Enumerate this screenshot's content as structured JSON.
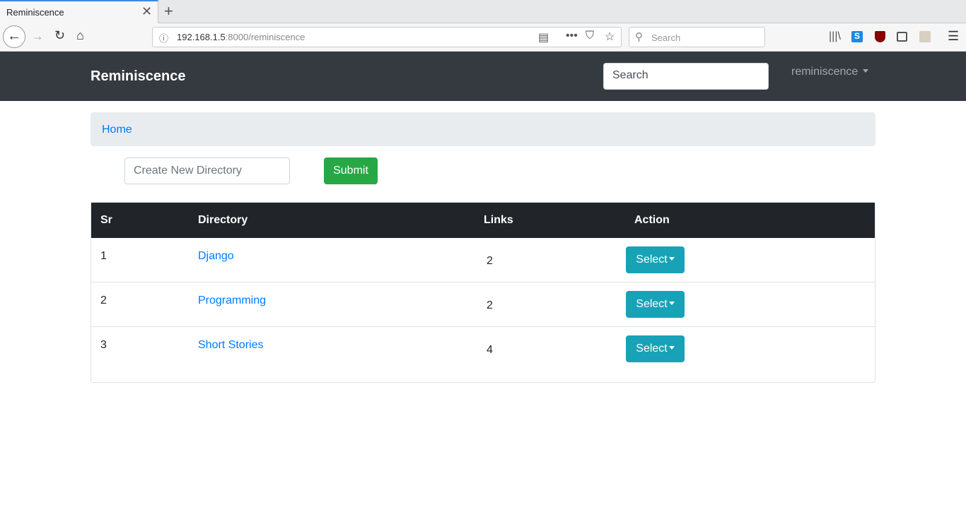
{
  "browser": {
    "tab_title": "Reminiscence",
    "url_host": "192.168.1.5",
    "url_rest": ":8000/reminiscence",
    "search_placeholder": "Search"
  },
  "app": {
    "brand": "Reminiscence",
    "search_placeholder": "Search",
    "user_menu": "reminiscence"
  },
  "breadcrumb": {
    "home": "Home"
  },
  "form": {
    "placeholder": "Create New Directory",
    "submit": "Submit"
  },
  "table": {
    "headers": {
      "sr": "Sr",
      "directory": "Directory",
      "links": "Links",
      "action": "Action"
    },
    "rows": [
      {
        "sr": "1",
        "directory": "Django",
        "links": "2",
        "action": "Select"
      },
      {
        "sr": "2",
        "directory": "Programming",
        "links": "2",
        "action": "Select"
      },
      {
        "sr": "3",
        "directory": "Short Stories",
        "links": "4",
        "action": "Select"
      }
    ]
  },
  "colors": {
    "navbar": "#343a40",
    "submit": "#28a745",
    "select": "#17a2b8",
    "link": "#007bff"
  }
}
